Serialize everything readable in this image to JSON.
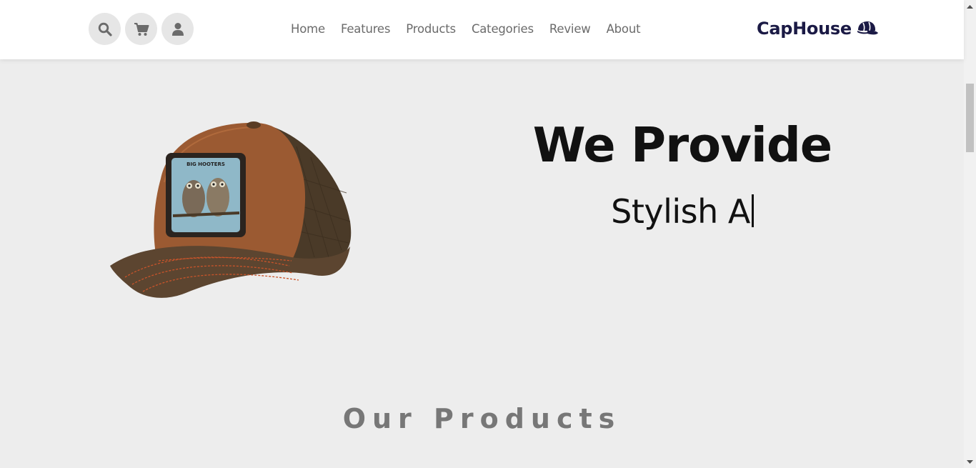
{
  "header": {
    "icons": [
      "search-icon",
      "shopping-cart-icon",
      "user-icon"
    ],
    "nav": [
      "Home",
      "Features",
      "Products",
      "Categories",
      "Review",
      "About"
    ],
    "brand": "CapHouse",
    "brand_icon": "cap-icon",
    "colors": {
      "brand": "#1b1a45",
      "nav": "#6b6b6b",
      "icon_bg": "#e6e6e6"
    }
  },
  "hero": {
    "title": "We Provide",
    "subtitle": "Stylish A",
    "image_label": "BIG HOOTERS"
  },
  "products_section": {
    "title": "Our Products"
  },
  "colors": {
    "page_bg": "#ededed",
    "header_bg": "#ffffff"
  }
}
